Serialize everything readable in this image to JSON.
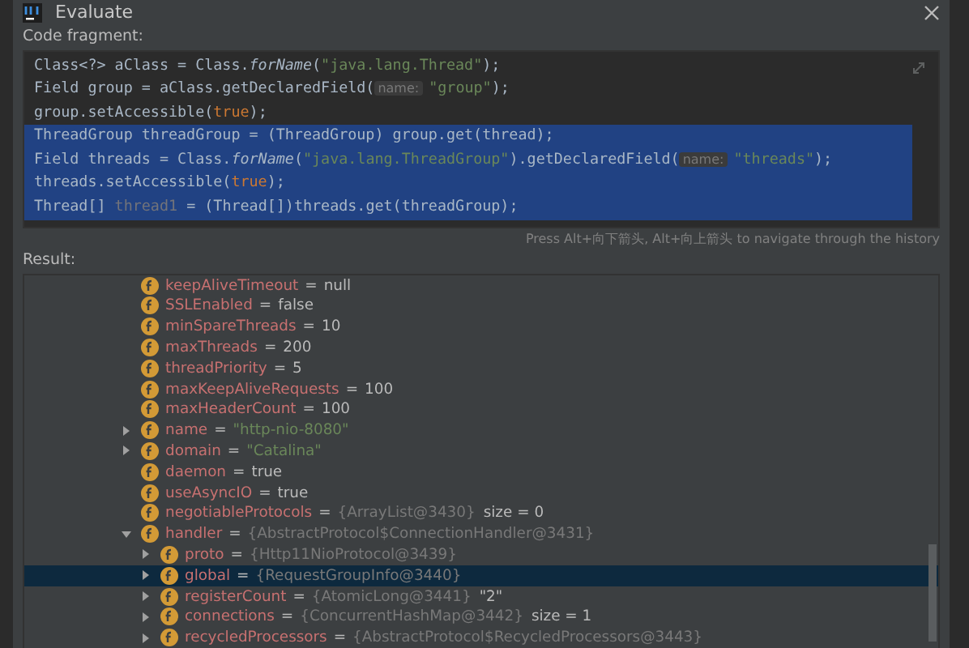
{
  "window": {
    "title": "Evaluate"
  },
  "code_fragment": {
    "label": "Code fragment:",
    "lines": [
      {
        "selected": false,
        "tokens": [
          {
            "kind": "plain",
            "text": "Class<?> aClass = Class."
          },
          {
            "kind": "method",
            "text": "forName"
          },
          {
            "kind": "plain",
            "text": "("
          },
          {
            "kind": "string",
            "text": "\"java.lang.Thread\""
          },
          {
            "kind": "plain",
            "text": ");"
          }
        ]
      },
      {
        "selected": false,
        "tokens": [
          {
            "kind": "plain",
            "text": "Field group = aClass.getDeclaredField("
          },
          {
            "kind": "hint",
            "text": "name:"
          },
          {
            "kind": "string",
            "text": "\"group\""
          },
          {
            "kind": "plain",
            "text": ");"
          }
        ]
      },
      {
        "selected": false,
        "tokens": [
          {
            "kind": "plain",
            "text": "group.setAccessible("
          },
          {
            "kind": "keyword",
            "text": "true"
          },
          {
            "kind": "plain",
            "text": ");"
          }
        ]
      },
      {
        "selected": true,
        "tokens": [
          {
            "kind": "plain",
            "text": "ThreadGroup threadGroup = (ThreadGroup) group.get(thread);"
          }
        ]
      },
      {
        "selected": true,
        "tokens": [
          {
            "kind": "plain",
            "text": "Field threads = Class."
          },
          {
            "kind": "method",
            "text": "forName"
          },
          {
            "kind": "plain",
            "text": "("
          },
          {
            "kind": "string",
            "text": "\"java.lang.ThreadGroup\""
          },
          {
            "kind": "plain",
            "text": ").getDeclaredField("
          },
          {
            "kind": "hint",
            "text": "name:"
          },
          {
            "kind": "string",
            "text": "\"threads\""
          },
          {
            "kind": "plain",
            "text": ");"
          }
        ]
      },
      {
        "selected": true,
        "tokens": [
          {
            "kind": "plain",
            "text": "threads.setAccessible("
          },
          {
            "kind": "keyword",
            "text": "true"
          },
          {
            "kind": "plain",
            "text": ");"
          }
        ]
      },
      {
        "selected": true,
        "tokens": [
          {
            "kind": "plain",
            "text": "Thread[] "
          },
          {
            "kind": "unused",
            "text": "thread1"
          },
          {
            "kind": "plain",
            "text": " = (Thread[])threads.get(threadGroup);"
          }
        ]
      }
    ],
    "hint": "Press Alt+向下箭头, Alt+向上箭头 to navigate through the history"
  },
  "result": {
    "label": "Result:",
    "items": [
      {
        "name": "keepAliveTimeout",
        "equals": "=",
        "value": "null",
        "kind": "plain",
        "selected": false
      },
      {
        "name": "SSLEnabled",
        "equals": "=",
        "value": "false",
        "kind": "plain",
        "selected": false
      },
      {
        "name": "minSpareThreads",
        "equals": "=",
        "value": "10",
        "kind": "plain",
        "selected": false
      },
      {
        "name": "maxThreads",
        "equals": "=",
        "value": "200",
        "kind": "plain",
        "selected": false
      },
      {
        "name": "threadPriority",
        "equals": "=",
        "value": "5",
        "kind": "plain",
        "selected": false
      },
      {
        "name": "maxKeepAliveRequests",
        "equals": "=",
        "value": "100",
        "kind": "plain",
        "selected": false
      },
      {
        "name": "maxHeaderCount",
        "equals": "=",
        "value": "100",
        "kind": "plain",
        "selected": false
      },
      {
        "name": "name",
        "equals": "=",
        "value": "\"http-nio-8080\"",
        "kind": "string",
        "expanded": false,
        "selected": false
      },
      {
        "name": "domain",
        "equals": "=",
        "value": "\"Catalina\"",
        "kind": "string",
        "expanded": false,
        "selected": false
      },
      {
        "name": "daemon",
        "equals": "=",
        "value": "true",
        "kind": "plain",
        "selected": false
      },
      {
        "name": "useAsyncIO",
        "equals": "=",
        "value": "true",
        "kind": "plain",
        "selected": false
      },
      {
        "name": "negotiableProtocols",
        "equals": "=",
        "value": "{ArrayList@3430}",
        "kind": "ref",
        "extra": "size = 0",
        "selected": false
      },
      {
        "name": "handler",
        "equals": "=",
        "value": "{AbstractProtocol$ConnectionHandler@3431}",
        "kind": "ref",
        "expanded": true,
        "selected": false,
        "children": [
          {
            "name": "proto",
            "equals": "=",
            "value": "{Http11NioProtocol@3439}",
            "kind": "ref",
            "expanded": false,
            "selected": false
          },
          {
            "name": "global",
            "equals": "=",
            "value": "{RequestGroupInfo@3440}",
            "kind": "ref",
            "expanded": false,
            "selected": true
          },
          {
            "name": "registerCount",
            "equals": "=",
            "value": "{AtomicLong@3441}",
            "kind": "ref",
            "extra": "\"2\"",
            "expanded": false,
            "selected": false
          },
          {
            "name": "connections",
            "equals": "=",
            "value": "{ConcurrentHashMap@3442}",
            "kind": "ref",
            "extra": "size = 1",
            "expanded": false,
            "selected": false
          },
          {
            "name": "recycledProcessors",
            "equals": "=",
            "value": "{AbstractProtocol$RecycledProcessors@3443}",
            "kind": "ref",
            "expanded": false,
            "selected": false
          }
        ]
      }
    ]
  }
}
